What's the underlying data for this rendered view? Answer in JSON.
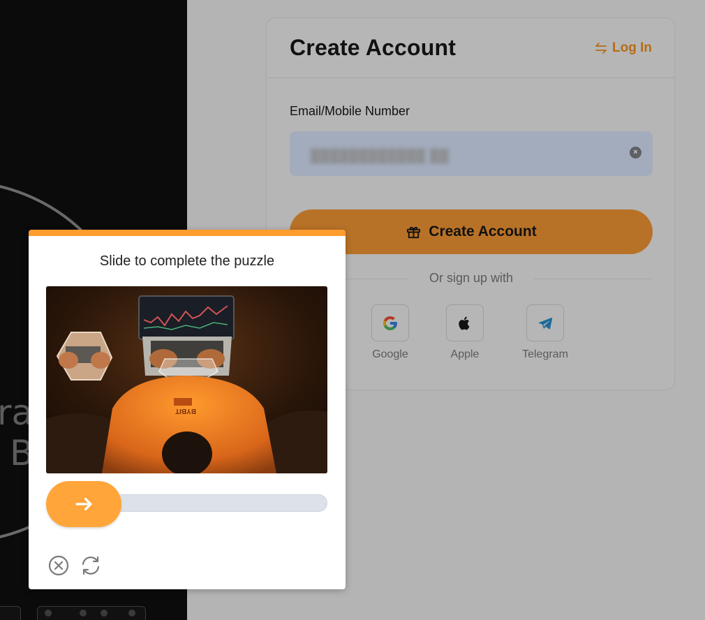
{
  "background": {
    "hero_heading_lines": [
      "ra",
      "B"
    ]
  },
  "signup": {
    "title": "Create Account",
    "login_label": "Log In",
    "email_label": "Email/Mobile Number",
    "email_value": "████████████ ██",
    "create_button_label": "Create Account",
    "divider_text": "Or sign up with",
    "social": [
      {
        "label": "Google",
        "icon": "google-icon"
      },
      {
        "label": "Apple",
        "icon": "apple-icon"
      },
      {
        "label": "Telegram",
        "icon": "telegram-icon"
      }
    ]
  },
  "captcha": {
    "title": "Slide to complete the puzzle",
    "image_watermark": "BYBIT",
    "slider_progress": 0,
    "accent_color": "#ff9c2e",
    "close_icon": "close-circle-icon",
    "refresh_icon": "refresh-icon"
  },
  "colors": {
    "brand_orange": "#f7a600",
    "link_orange": "#b66b17"
  }
}
